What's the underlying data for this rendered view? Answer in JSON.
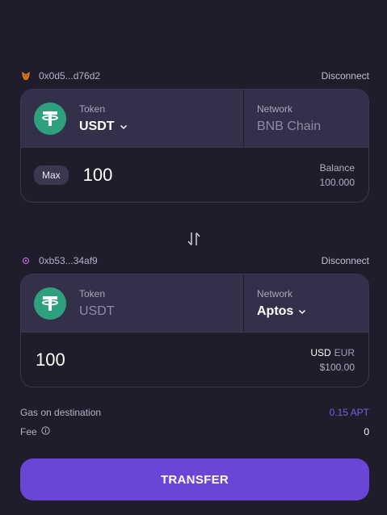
{
  "source": {
    "wallet_address": "0x0d5...d76d2",
    "wallet_icon": "metamask-fox-icon",
    "disconnect_label": "Disconnect",
    "token_label": "Token",
    "token_value": "USDT",
    "network_label": "Network",
    "network_value": "BNB Chain",
    "max_label": "Max",
    "amount": "100",
    "balance_label": "Balance",
    "balance_value": "100.000"
  },
  "destination": {
    "wallet_address": "0xb53...34af9",
    "wallet_icon": "petra-wallet-icon",
    "disconnect_label": "Disconnect",
    "token_label": "Token",
    "token_value": "USDT",
    "network_label": "Network",
    "network_value": "Aptos",
    "amount": "100",
    "currency_active": "USD",
    "currency_inactive": "EUR",
    "usd_value": "$100.00"
  },
  "swap_icon": "swap-vertical-arrows-icon",
  "info": {
    "gas_label": "Gas on destination",
    "gas_value": "0.15 APT",
    "fee_label": "Fee",
    "fee_value": "0"
  },
  "transfer_label": "TRANSFER",
  "colors": {
    "background": "#1f1d2c",
    "card_top": "#33314a",
    "accent": "#6a45d6",
    "gas_value": "#7a5ee0",
    "tether_green": "#2fa07d"
  }
}
